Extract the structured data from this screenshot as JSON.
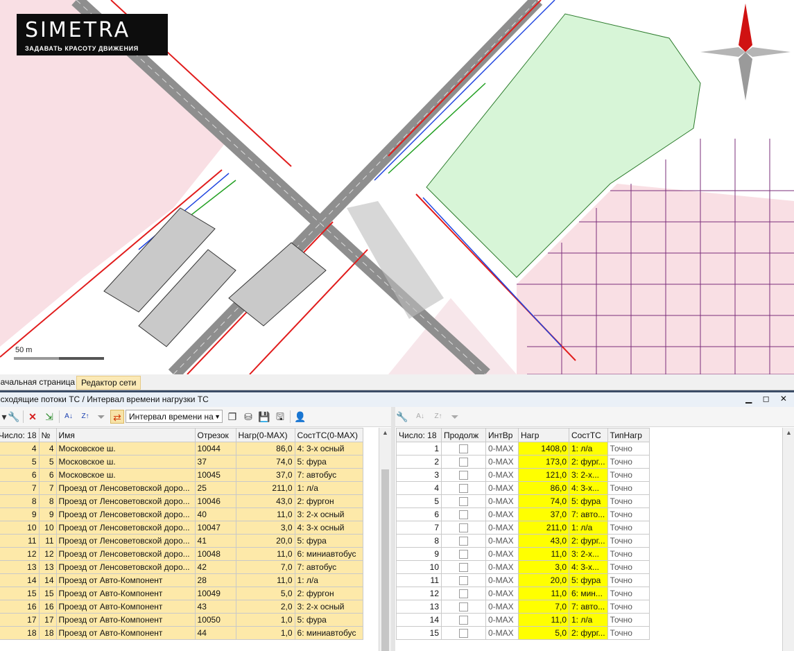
{
  "logo": {
    "brand": "SIMETRA",
    "slogan": "ЗАДАВАТЬ КРАСОТУ ДВИЖЕНИЯ"
  },
  "map": {
    "scale_label": "50 m"
  },
  "tabs": [
    {
      "label": "Начальная страница"
    },
    {
      "label": "Редактор сети"
    }
  ],
  "panel": {
    "title": "Исходящие потоки ТС / Интервал времени нагрузки ТС",
    "window_buttons": "▁ ◻ ✕"
  },
  "toolbar": {
    "interval_combo": "Интервал времени на"
  },
  "left_table": {
    "columns": [
      "Число: 18",
      "№",
      "Имя",
      "Отрезок",
      "Нагр(0-MAX)",
      "СостТС(0-MAX)"
    ],
    "rows": [
      [
        "4",
        "4",
        "Московское ш.",
        "10044",
        "86,0",
        "4: 3-х осный"
      ],
      [
        "5",
        "5",
        "Московское ш.",
        "37",
        "74,0",
        "5: фура"
      ],
      [
        "6",
        "6",
        "Московское ш.",
        "10045",
        "37,0",
        "7: автобус"
      ],
      [
        "7",
        "7",
        "Проезд  от  Ленсоветовской доро...",
        "25",
        "211,0",
        "1: л/а"
      ],
      [
        "8",
        "8",
        "Проезд  от  Ленсоветовской доро...",
        "10046",
        "43,0",
        "2: фургон"
      ],
      [
        "9",
        "9",
        "Проезд  от  Ленсоветовской доро...",
        "40",
        "11,0",
        "3: 2-х осный"
      ],
      [
        "10",
        "10",
        "Проезд  от  Ленсоветовской доро...",
        "10047",
        "3,0",
        "4: 3-х осный"
      ],
      [
        "11",
        "11",
        "Проезд  от  Ленсоветовской доро...",
        "41",
        "20,0",
        "5: фура"
      ],
      [
        "12",
        "12",
        "Проезд  от  Ленсоветовской доро...",
        "10048",
        "11,0",
        "6: миниавтобус"
      ],
      [
        "13",
        "13",
        "Проезд  от  Ленсоветовской доро...",
        "42",
        "7,0",
        "7: автобус"
      ],
      [
        "14",
        "14",
        "Проезд от Авто-Компонент",
        "28",
        "11,0",
        "1: л/а"
      ],
      [
        "15",
        "15",
        "Проезд от Авто-Компонент",
        "10049",
        "5,0",
        "2: фургон"
      ],
      [
        "16",
        "16",
        "Проезд от Авто-Компонент",
        "43",
        "2,0",
        "3: 2-х осный"
      ],
      [
        "17",
        "17",
        "Проезд от Авто-Компонент",
        "10050",
        "1,0",
        "5: фура"
      ],
      [
        "18",
        "18",
        "Проезд от Авто-Компонент",
        "44",
        "1,0",
        "6: миниавтобус"
      ]
    ]
  },
  "right_table": {
    "columns": [
      "Число: 18",
      "Продолж",
      "ИнтВр",
      "Нагр",
      "СостТС",
      "ТипНагр"
    ],
    "rows": [
      [
        "1",
        "0-MAX",
        "1408,0",
        "1: л/а",
        "Точно"
      ],
      [
        "2",
        "0-MAX",
        "173,0",
        "2: фург...",
        "Точно"
      ],
      [
        "3",
        "0-MAX",
        "121,0",
        "3: 2-х...",
        "Точно"
      ],
      [
        "4",
        "0-MAX",
        "86,0",
        "4: 3-х...",
        "Точно"
      ],
      [
        "5",
        "0-MAX",
        "74,0",
        "5: фура",
        "Точно"
      ],
      [
        "6",
        "0-MAX",
        "37,0",
        "7: авто...",
        "Точно"
      ],
      [
        "7",
        "0-MAX",
        "211,0",
        "1: л/а",
        "Точно"
      ],
      [
        "8",
        "0-MAX",
        "43,0",
        "2: фург...",
        "Точно"
      ],
      [
        "9",
        "0-MAX",
        "11,0",
        "3: 2-х...",
        "Точно"
      ],
      [
        "10",
        "0-MAX",
        "3,0",
        "4: 3-х...",
        "Точно"
      ],
      [
        "11",
        "0-MAX",
        "20,0",
        "5: фура",
        "Точно"
      ],
      [
        "12",
        "0-MAX",
        "11,0",
        "6: мин...",
        "Точно"
      ],
      [
        "13",
        "0-MAX",
        "7,0",
        "7: авто...",
        "Точно"
      ],
      [
        "14",
        "0-MAX",
        "11,0",
        "1: л/а",
        "Точно"
      ],
      [
        "15",
        "0-MAX",
        "5,0",
        "2: фург...",
        "Точно"
      ]
    ]
  }
}
